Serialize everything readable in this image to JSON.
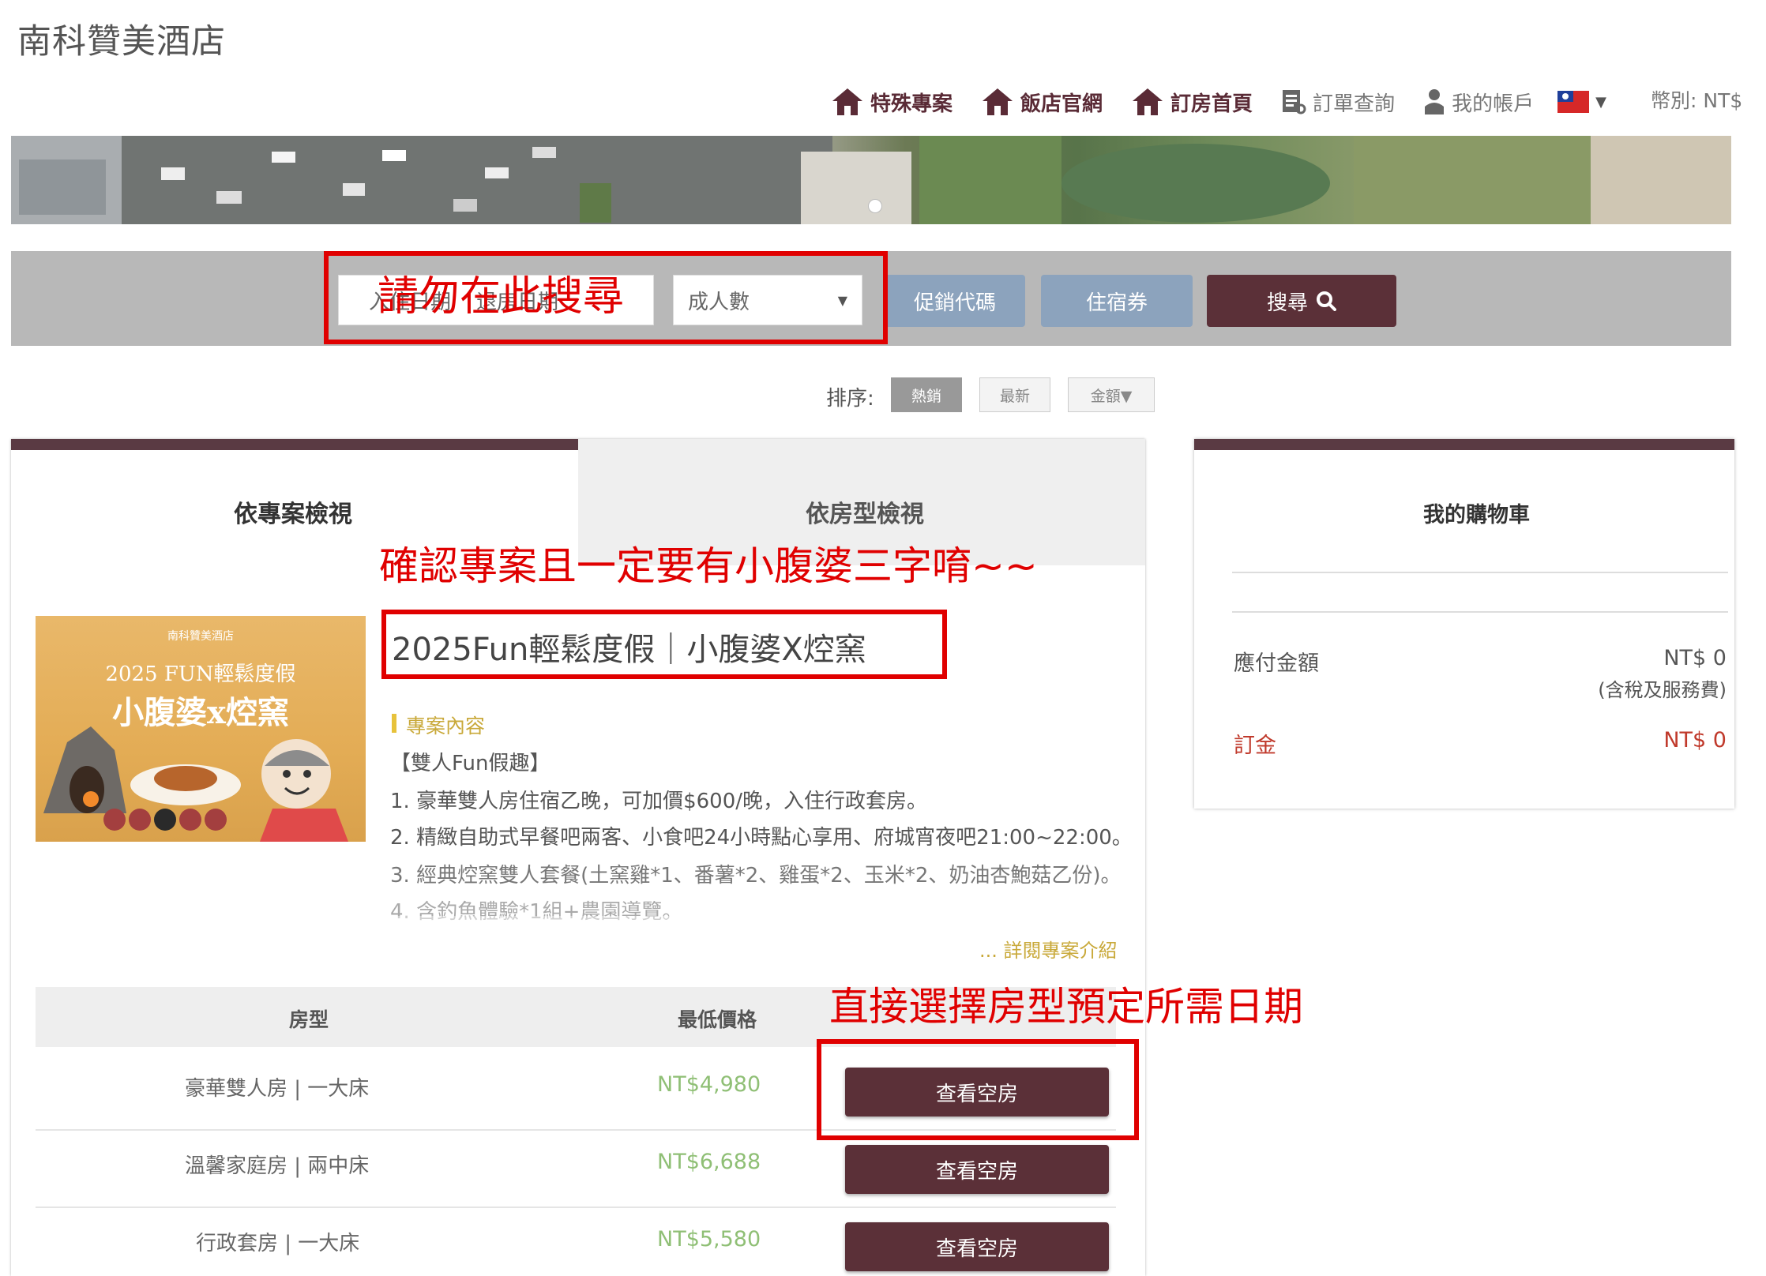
{
  "hotel_name": "南科贊美酒店",
  "nav": {
    "special": "特殊專案",
    "official": "飯店官網",
    "booking_home": "訂房首頁",
    "order_query": "訂單查詢",
    "my_account": "我的帳戶",
    "currency": "幣別: NT$"
  },
  "search": {
    "date_placeholder_1": "入住日期",
    "date_placeholder_2": "退房日期",
    "adults_placeholder": "成人數",
    "promo_button": "促銷代碼",
    "voucher_button": "住宿券",
    "search_button": "搜尋"
  },
  "sort": {
    "label": "排序:",
    "hot": "熱銷",
    "newest": "最新",
    "price": "金額▼"
  },
  "tabs": {
    "by_plan": "依專案檢視",
    "by_room": "依房型檢視"
  },
  "plan": {
    "title": "2025Fun輕鬆度假｜小腹婆X焢窯",
    "image_title": "2025 FUN輕鬆度假",
    "image_subtitle": "小腹婆x焢窯",
    "section_label": "專案內容",
    "lines": [
      "【雙人Fun假趣】",
      "1. 豪華雙人房住宿乙晚，可加價$600/晚，入住行政套房。",
      "2. 精緻自助式早餐吧兩客、小食吧24小時點心享用、府城宵夜吧21:00~22:00。",
      "3. 經典焢窯雙人套餐(土窯雞*1、番薯*2、雞蛋*2、玉米*2、奶油杏鮑菇乙份)。",
      "4. 含釣魚體驗*1組+農園導覽。"
    ],
    "more_link": "... 詳閱專案介紹"
  },
  "table": {
    "col_room": "房型",
    "col_price": "最低價格",
    "rows": [
      {
        "name": "豪華雙人房 | 一大床",
        "price": "NT$4,980",
        "button": "查看空房"
      },
      {
        "name": "溫馨家庭房 | 兩中床",
        "price": "NT$6,688",
        "button": "查看空房"
      },
      {
        "name": "行政套房 | 一大床",
        "price": "NT$5,580",
        "button": "查看空房"
      }
    ]
  },
  "cart": {
    "title": "我的購物車",
    "payable_label": "應付金額",
    "payable_value": "NT$ 0",
    "tax_note": "(含稅及服務費)",
    "deposit_label": "訂金",
    "deposit_value": "NT$ 0"
  },
  "annotations": {
    "search_warning": "請勿在此搜尋",
    "plan_note": "確認專案且一定要有小腹婆三字唷~~",
    "room_note": "直接選擇房型預定所需日期"
  },
  "colors": {
    "brand": "#5b3038",
    "annotation": "#e00000",
    "price": "#8fbf75",
    "deposit": "#c0392b"
  }
}
